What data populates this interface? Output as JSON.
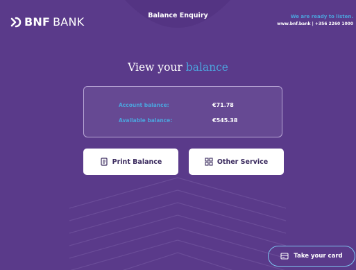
{
  "brand": {
    "bold": "BNF",
    "light": "BANK"
  },
  "header": {
    "title": "Balance Enquiry"
  },
  "contact": {
    "tagline": "We are ready to listen.",
    "details": "www.bnf.bank | +356 2260 1000"
  },
  "page": {
    "title_main": "View your",
    "title_accent": "balance"
  },
  "balance": {
    "account_label": "Account balance:",
    "account_value": "€71.78",
    "available_label": "Available balance:",
    "available_value": "€545.38"
  },
  "actions": {
    "print_label": "Print Balance",
    "other_label": "Other Service"
  },
  "footer": {
    "take_card_label": "Take your card"
  },
  "colors": {
    "background": "#5a3a8a",
    "accent": "#4ca3dd",
    "button_text": "#3a2a5e"
  },
  "icons": [
    "logo-icon",
    "document-icon",
    "grid-icon",
    "card-icon"
  ]
}
